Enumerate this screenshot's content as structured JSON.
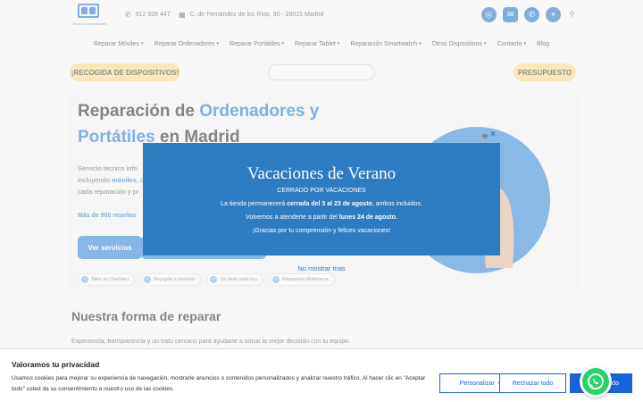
{
  "header": {
    "logo_caption": "Tecnico Ordenadores",
    "phone": "912 928 447",
    "address": "C. de Fernández de los Ríos, 30 - 28015 Madrid"
  },
  "nav": {
    "items": [
      {
        "label": "Reparar Móviles",
        "caret": true
      },
      {
        "label": "Reparar Ordenadores",
        "caret": true
      },
      {
        "label": "Reparar Portátiles",
        "caret": true
      },
      {
        "label": "Reparar Tablet",
        "caret": true
      },
      {
        "label": "Reparación Smartwatch",
        "caret": true
      },
      {
        "label": "Otros Dispositivos",
        "caret": true
      },
      {
        "label": "Contacto",
        "caret": true
      },
      {
        "label": "Blog",
        "caret": false
      }
    ]
  },
  "actions": {
    "recogida": "¡RECOGIDA DE DISPOSITIVOS!",
    "presupuesto": "PRESUPUESTO"
  },
  "hero": {
    "title_part1": "Reparación de ",
    "title_blue1": "Ordenadores y",
    "title_blue2": "Portátiles",
    "title_part2": " en Madrid",
    "text_1": "Servicio técnico info",
    "text_2": "incluyendo ",
    "text_bold": "móviles",
    "text_3": ", o",
    "text_4": "cada reparación y pr",
    "reviews": "Más de 900 reseñas",
    "btn_servicios": "Ver servicios",
    "badges": [
      "Taller en Chamberí",
      "Recogida a domicilio",
      "Sin pedir nada hoy",
      "Reparación Multimarca"
    ]
  },
  "section": {
    "title": "Nuestra forma de reparar",
    "text": "Experiencia, transparencia y un trato cercano para ayudarte a tomar la mejor decisión con tu equipo."
  },
  "modal": {
    "title": "Vacaciones de Verano",
    "subtitle": "CERRADO POR VACACIONES",
    "line1_pre": "La tienda permanecerá ",
    "line1_bold": "cerrada del 3 al 23 de agosto",
    "line1_post": ", ambos incluidos.",
    "line2_pre": "Volvemos a atenderte a partir del ",
    "line2_bold": "lunes 24 de agosto.",
    "line3": "¡Gracias por tu comprensión y felices vacaciones!",
    "close": "×",
    "no_show": "No mostrar mas"
  },
  "cookie": {
    "title": "Valoramos tu privacidad",
    "text": "Usamos cookies para mejorar su experiencia de navegación, mostrarle anuncios o contenidos personalizados y analizar nuestro tráfico. Al hacer clic en \"Aceptar todo\" usted da su consentimiento a nuestro uso de las cookies.",
    "personalizar": "Personalizar",
    "rechazar": "Rechazar todo",
    "aceptar": "Aceptar todo"
  },
  "colors": {
    "brand_blue": "#2c7bd0",
    "modal_blue": "#2d7cc1",
    "cookie_blue": "#1863dc",
    "yellow": "#f5d98a",
    "whatsapp": "#25d366"
  }
}
